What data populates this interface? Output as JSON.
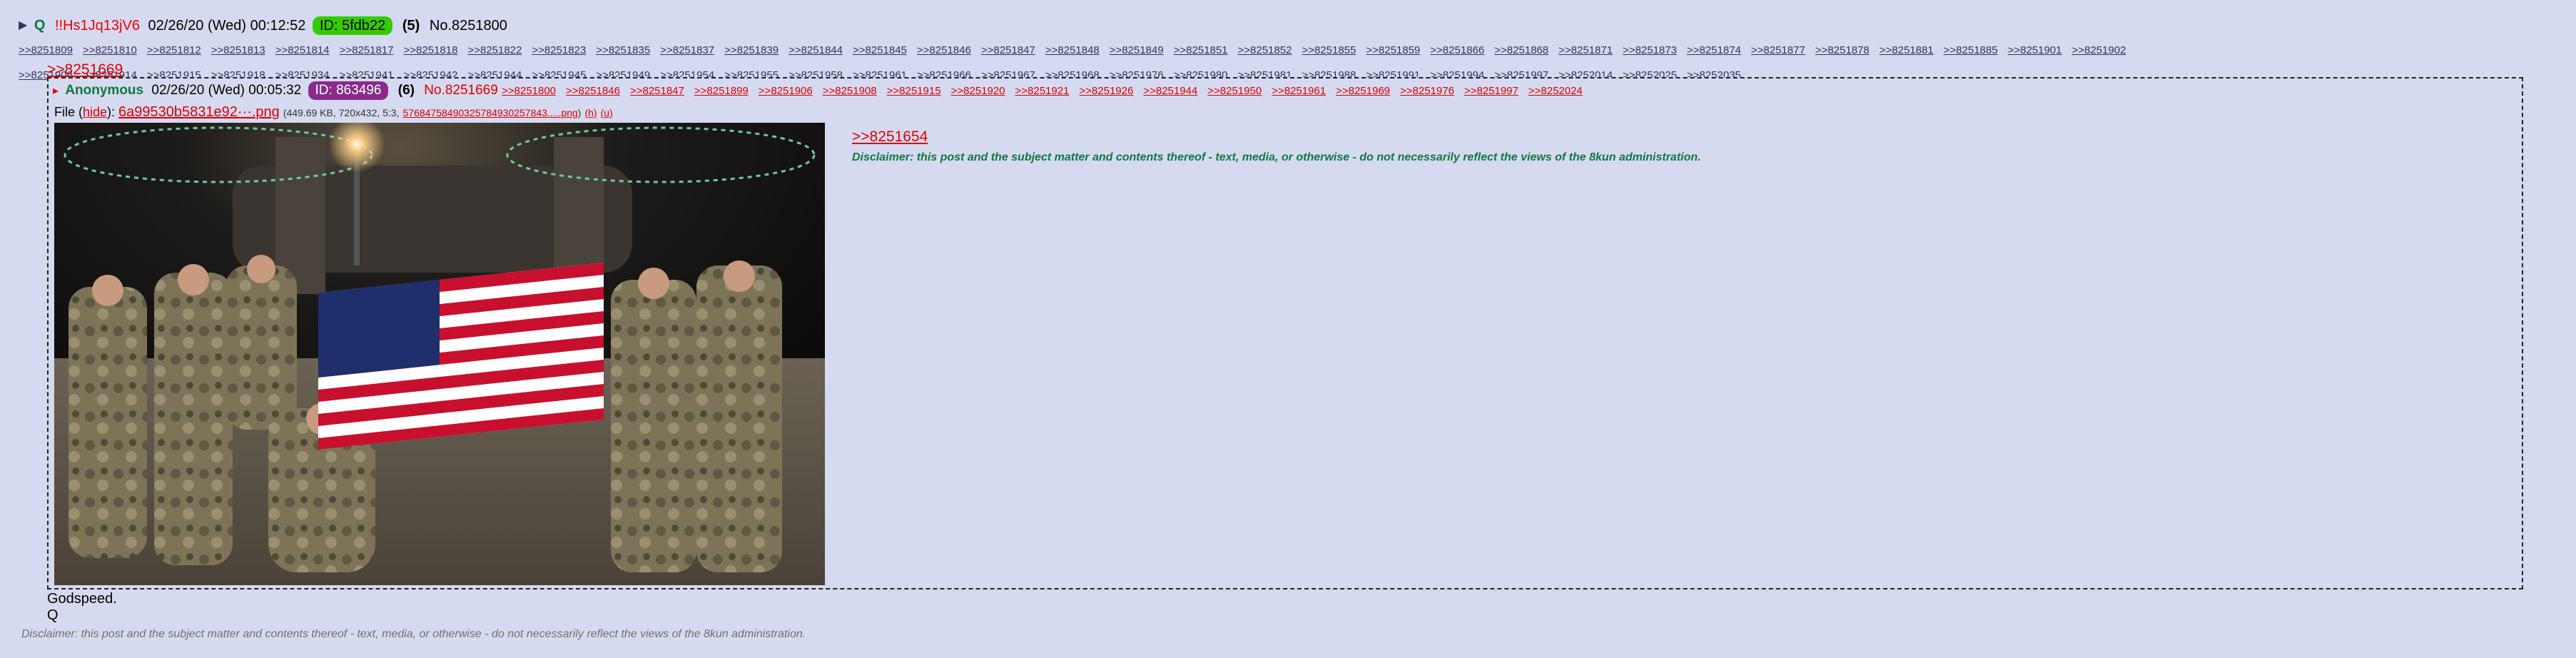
{
  "post": {
    "expand_icon": "triangle-right-icon",
    "name": "Q",
    "tripcode": "!!Hs1Jq13jV6",
    "date": "02/26/20 (Wed) 00:12:52",
    "id_label": "ID: 5fdb22",
    "id_color": "#33cc00",
    "reply_count": "(5)",
    "post_no": "No.8251800",
    "backlinks_row1": [
      ">>8251809",
      ">>8251810",
      ">>8251812",
      ">>8251813",
      ">>8251814",
      ">>8251817",
      ">>8251818",
      ">>8251822",
      ">>8251823",
      ">>8251835",
      ">>8251837",
      ">>8251839",
      ">>8251844",
      ">>8251845",
      ">>8251846",
      ">>8251847",
      ">>8251848",
      ">>8251849",
      ">>8251851",
      ">>8251852",
      ">>8251855",
      ">>8251859",
      ">>8251866",
      ">>8251868",
      ">>8251871",
      ">>8251873",
      ">>8251874",
      ">>8251877",
      ">>8251878",
      ">>8251881",
      ">>8251885",
      ">>8251901",
      ">>8251902"
    ],
    "backlinks_row2": [
      ">>8251906",
      ">>8251914",
      ">>8251915",
      ">>8251918",
      ">>8251934",
      ">>8251941",
      ">>8251942",
      ">>8251944",
      ">>8251945",
      ">>8251949",
      ">>8251954",
      ">>8251955",
      ">>8251958",
      ">>8251961",
      ">>8251966",
      ">>8251967",
      ">>8251968",
      ">>8251976",
      ">>8251980",
      ">>8251981",
      ">>8251988",
      ">>8251991",
      ">>8251994",
      ">>8251997",
      ">>8252014",
      ">>8252025",
      ">>8252035"
    ],
    "reply_ref": ">>8251669",
    "message_line1": "Godspeed.",
    "message_line2": "Q",
    "footer_disclaimer": "Disclaimer: this post and the subject matter and contents thereof - text, media, or otherwise - do not necessarily reflect the views of the 8kun administration."
  },
  "reply": {
    "expand_icon": "triangle-right-icon",
    "name": "Anonymous",
    "date": "02/26/20 (Wed) 00:05:32",
    "id_label": "ID: 863496",
    "id_color": "#8a2a8a",
    "reply_count": "(6)",
    "post_no": "No.8251669",
    "backlinks": [
      ">>8251800",
      ">>8251846",
      ">>8251847",
      ">>8251899",
      ">>8251906",
      ">>8251908",
      ">>8251915",
      ">>8251920",
      ">>8251921",
      ">>8251926",
      ">>8251944",
      ">>8251950",
      ">>8251961",
      ">>8251969",
      ">>8251976",
      ">>8251997",
      ">>8252024"
    ],
    "file_prefix": "File (",
    "file_hide": "hide",
    "file_mid": "): ",
    "file_name": "6a99530b5831e92···.png",
    "file_meta": "(449.69 KB, 720x432, 5:3,",
    "file_fullname": "57684758490325784930257843.....png",
    "file_meta_end": ")",
    "file_h": "(h)",
    "file_u": "(u)",
    "quote_link": ">>8251654",
    "disclaimer": "Disclaimer: this post and the subject matter and contents thereof - text, media, or otherwise - do not necessarily reflect the views of the 8kun administration."
  },
  "colors": {
    "background": "#d6daf0",
    "name_green": "#117743",
    "link_red": "#dd0000",
    "link_blue": "#34345c"
  }
}
